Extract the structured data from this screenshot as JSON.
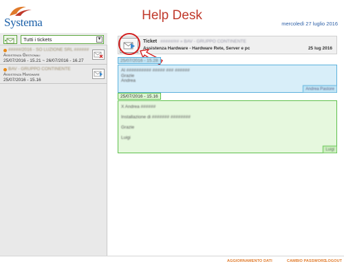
{
  "header": {
    "logo_text": "Systema",
    "title": "Help Desk",
    "date": "mercoledì 27 luglio 2016"
  },
  "sidebar": {
    "filter_selected": "Tutti i tickets",
    "tickets": [
      {
        "title": "#####/2016 - SO LUZIONE SRL ######",
        "category": "Assistenza Gestionali",
        "dates": "25/07/2016 - 15.21 ~ 26/07/2016 - 16.27",
        "status_color": "#e88a1a"
      },
      {
        "title": "BAV - GRUPPO CONTINENTE",
        "category": "Assistenza Hardware",
        "dates": "25/07/2016 - 15.16",
        "status_color": "#e88a1a"
      }
    ]
  },
  "ticket": {
    "label": "Ticket",
    "id_text": "#####/## » BAV - GRUPPO CONTINENTE",
    "category": "Assistenza Hardware - Hardware Rete, Server e pc",
    "date": "25 lug 2016"
  },
  "messages": [
    {
      "timestamp": "25/07/2016 - 15.28",
      "lines": [
        "Al ########## ##### ### ######",
        "Grazie",
        "Andrea"
      ],
      "signature": "Andrea Pastore"
    },
    {
      "timestamp": "25/07/2016 - 15.16",
      "lines": [
        "X Andrea ######",
        "Installazione di ####### ########",
        "Grazie",
        "Luigi"
      ],
      "signature": "Luigi"
    }
  ],
  "footer": {
    "links": [
      "AGGIORNAMENTO DATI",
      "CAMBIO PASSWORD",
      "LOGOUT"
    ]
  },
  "colors": {
    "title": "#c0392b",
    "accent": "#1a5fa8",
    "footer_link": "#e07a2a",
    "message_blue": "#d8eef9",
    "message_green": "#e6f8de",
    "highlight_red": "#d32020"
  }
}
